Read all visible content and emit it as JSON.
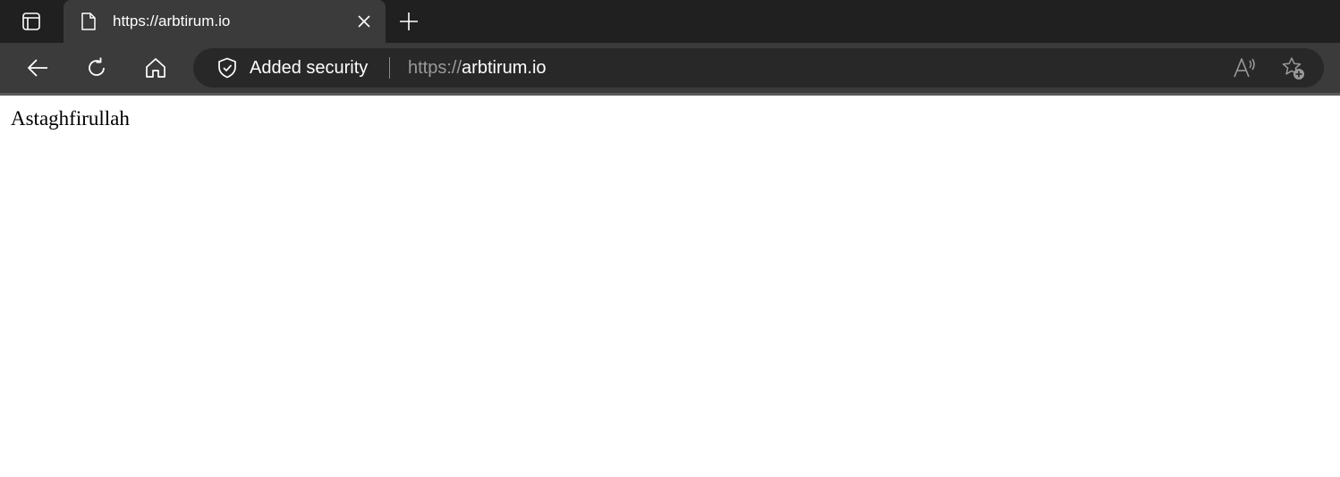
{
  "tab": {
    "title": "https://arbtirum.io"
  },
  "address_bar": {
    "security_label": "Added security",
    "url_scheme": "https://",
    "url_host": "arbtirum.io"
  },
  "page": {
    "text": "Astaghfirullah"
  },
  "icons": {
    "tab_actions": "tab-actions-icon",
    "favicon": "page-icon",
    "close": "close-icon",
    "new_tab": "plus-icon",
    "back": "back-arrow-icon",
    "refresh": "refresh-icon",
    "home": "home-icon",
    "shield": "shield-check-icon",
    "read_aloud": "read-aloud-icon",
    "add_favorite": "star-add-icon"
  },
  "colors": {
    "tabstrip_bg": "#202020",
    "toolbar_bg": "#3b3b3b",
    "address_bg": "#282828",
    "url_scheme": "#9a9a9a",
    "text_light": "#ffffff"
  }
}
